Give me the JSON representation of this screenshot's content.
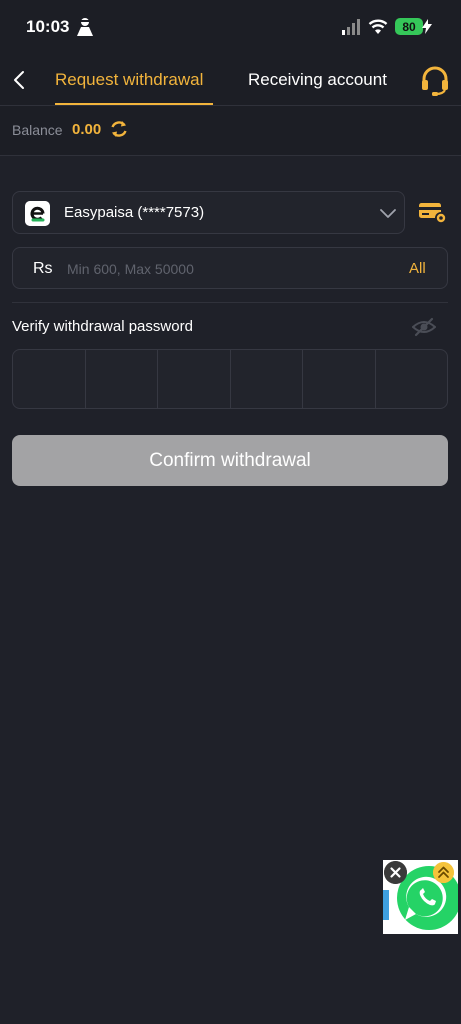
{
  "status_bar": {
    "time": "10:03",
    "battery": "80"
  },
  "header": {
    "tabs": [
      {
        "label": "Request withdrawal",
        "active": true
      },
      {
        "label": "Receiving account",
        "active": false
      }
    ],
    "icons": {
      "back": "chevron-left-icon",
      "support": "headset-icon"
    }
  },
  "balance": {
    "label": "Balance",
    "value": "0.00"
  },
  "account": {
    "name": "Easypaisa (****7573)",
    "logo": "easypaisa-logo"
  },
  "amount": {
    "currency": "Rs",
    "placeholder": "Min 600, Max 50000",
    "all_label": "All"
  },
  "password": {
    "label": "Verify withdrawal password",
    "digits": 6
  },
  "confirm_label": "Confirm withdrawal",
  "colors": {
    "accent": "#f2b43c",
    "background": "#1f2129",
    "button_disabled": "#a3a3a5",
    "battery": "#35c759",
    "whatsapp": "#25d366"
  }
}
